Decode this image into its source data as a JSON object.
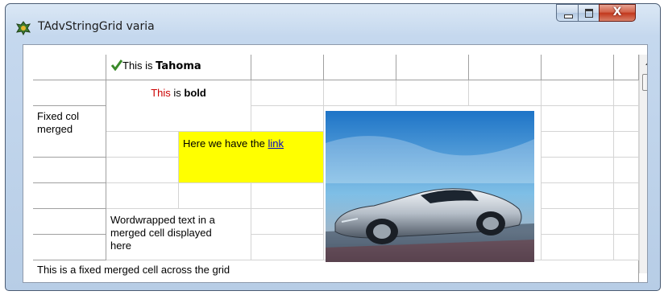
{
  "window": {
    "title": "TAdvStringGrid varia"
  },
  "cells": {
    "tahoma_prefix": "This is ",
    "tahoma_bold": "Tahoma",
    "bold_prefix_red": "This",
    "bold_mid": " is ",
    "bold_word": "bold",
    "fixed_col_merged": "Fixed col merged",
    "link_prefix": "Here we have the ",
    "link_text": "link",
    "wordwrap": "Wordwrapped text in a merged cell displayed here",
    "fixed_row_merged": "This is a fixed merged cell across the grid"
  },
  "colors": {
    "highlight": "#ffff00",
    "link": "#0000cc",
    "red_text": "#cc0000"
  },
  "icons": {
    "check": "check-icon",
    "app": "app-icon",
    "image": "car-image"
  }
}
